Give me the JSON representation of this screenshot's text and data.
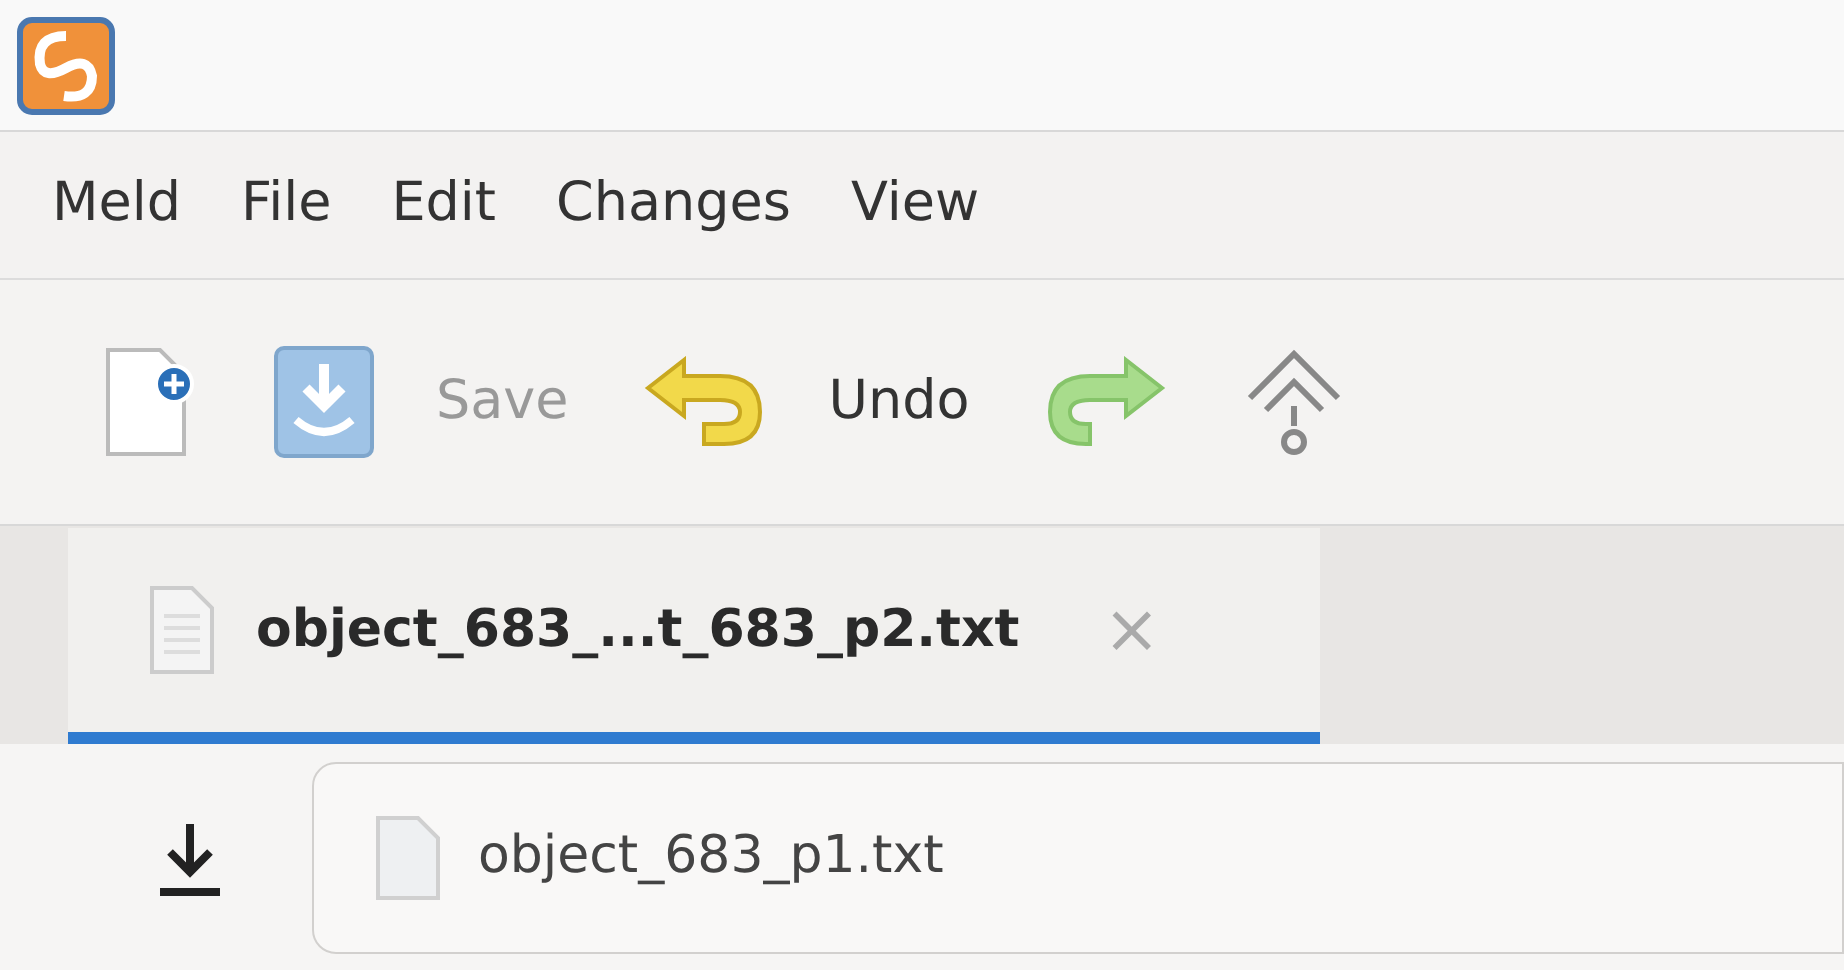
{
  "menu": [
    "Meld",
    "File",
    "Edit",
    "Changes",
    "View"
  ],
  "toolbar": [
    {
      "kind": "new"
    },
    {
      "kind": "save",
      "label": "Save",
      "disabled": true
    },
    {
      "kind": "undo",
      "label": "Undo",
      "disabled": false
    },
    {
      "kind": "redo"
    },
    {
      "kind": "up"
    }
  ],
  "tabs": [
    {
      "label": "object_683_...t_683_p2.txt",
      "selected": true,
      "close": "×"
    }
  ],
  "file_row": {
    "path": "object_683_p1.txt"
  }
}
